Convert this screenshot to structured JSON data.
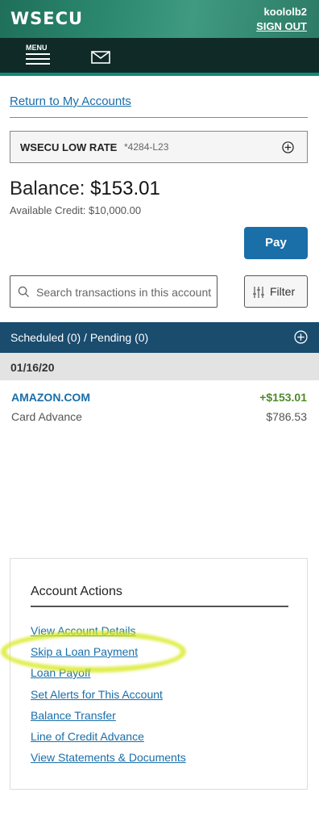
{
  "header": {
    "logo": "WSECU",
    "username": "koololb2",
    "sign_out": "SIGN OUT"
  },
  "nav": {
    "menu_label": "MENU",
    "mail_icon": "envelope-icon"
  },
  "return_link": "Return to My Accounts",
  "account": {
    "name": "WSECU LOW RATE",
    "number": "*4284-L23",
    "expand_icon": "plus-circle-icon"
  },
  "balance": {
    "label": "Balance:",
    "value": "$153.01",
    "available": "Available Credit: $10,000.00"
  },
  "pay_button": "Pay",
  "search": {
    "placeholder": "Search transactions in this account"
  },
  "filter_button": "Filter",
  "scheduled": {
    "label": "Scheduled (0) / Pending (0)"
  },
  "transactions": {
    "date": "01/16/20",
    "rows": [
      {
        "name": "AMAZON.COM",
        "amount": "+$153.01",
        "type": "Card Advance",
        "balance": "$786.53"
      }
    ]
  },
  "account_actions": {
    "title": "Account Actions",
    "links": [
      "View Account Details",
      "Skip a Loan Payment",
      "Loan Payoff",
      "Set Alerts for This Account",
      "Balance Transfer",
      "Line of Credit Advance",
      "View Statements & Documents"
    ]
  },
  "colors": {
    "header_green": "#2c8a70",
    "nav_dark": "#102b27",
    "link_blue": "#1a6ea8",
    "pay_blue": "#1a6fa8",
    "scheduled_bar": "#1a4c6e",
    "amount_green": "#4f8a2a",
    "highlight": "#d6e814"
  }
}
